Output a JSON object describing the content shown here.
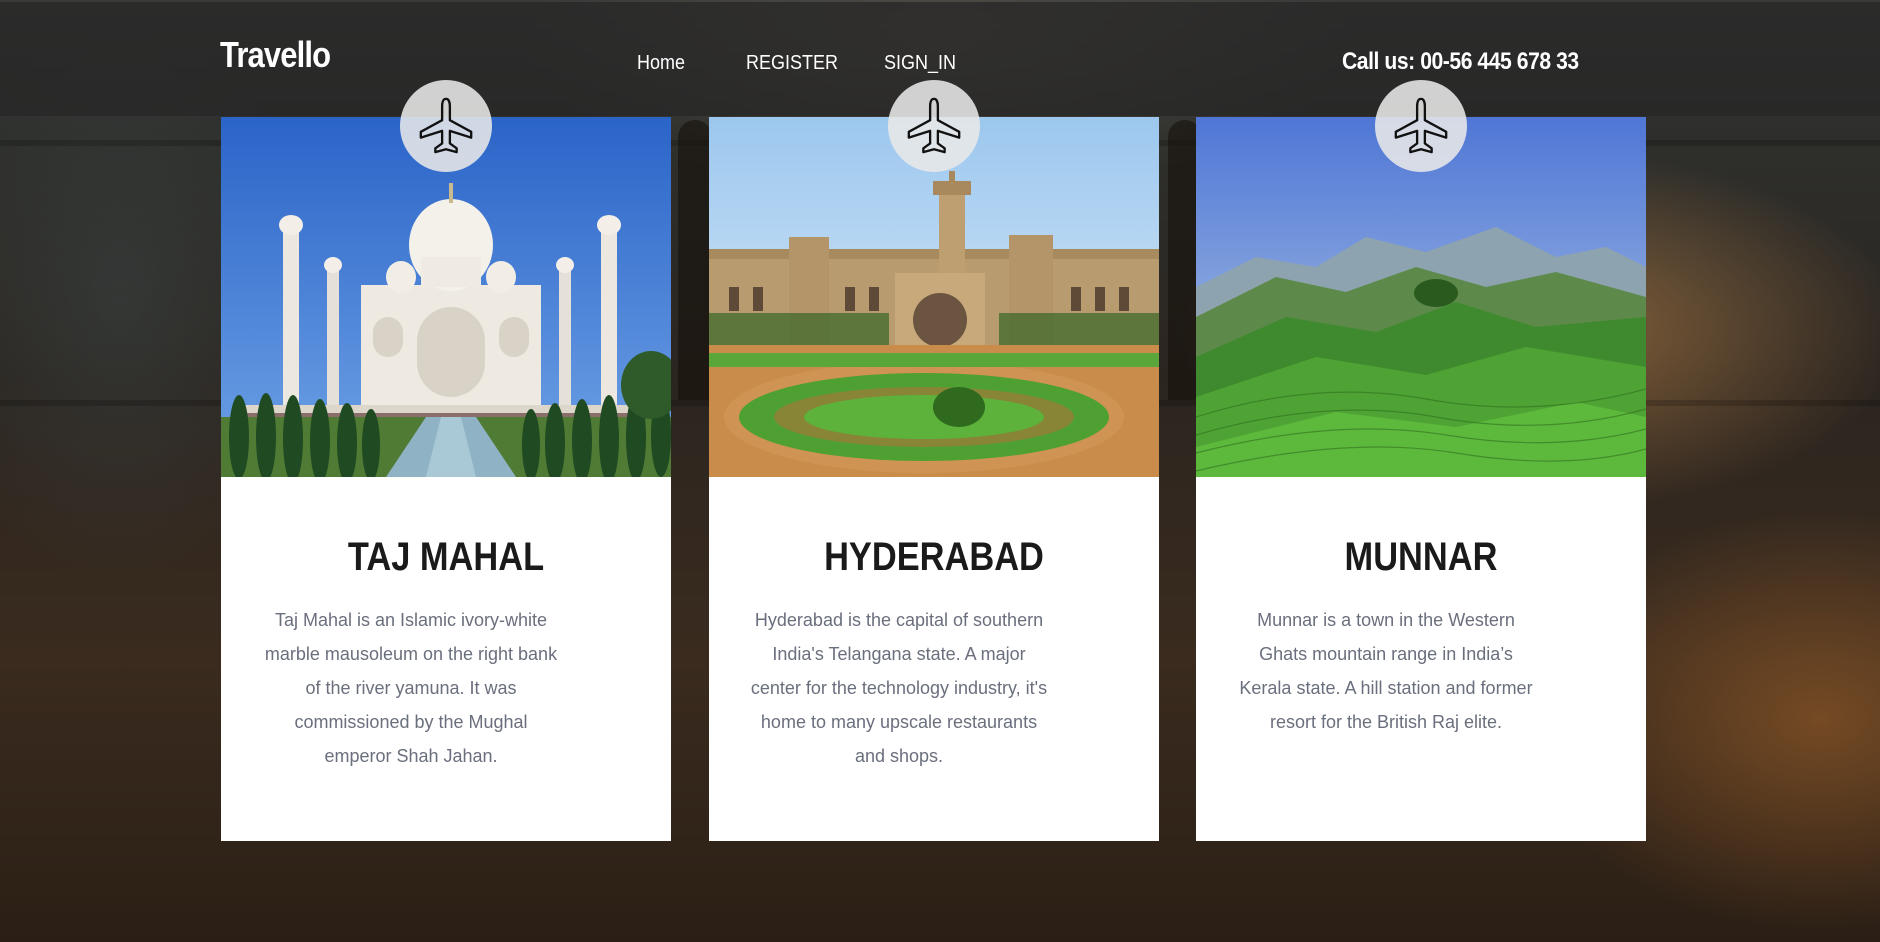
{
  "header": {
    "brand": "Travello",
    "nav": [
      {
        "label": "Home"
      },
      {
        "label": "REGISTER"
      },
      {
        "label": "SIGN_IN"
      }
    ],
    "phone": "Call us: 00-56 445 678 33"
  },
  "cards": [
    {
      "title": "TAJ MAHAL",
      "description": "Taj Mahal is an Islamic ivory-white marble mausoleum on the right bank of the river yamuna. It was commissioned by the Mughal emperor Shah Jahan.",
      "icon": "airplane-icon"
    },
    {
      "title": "HYDERABAD",
      "description": "Hyderabad is the capital of southern India's Telangana state. A major center for the technology industry, it's home to many upscale restaurants and shops.",
      "icon": "airplane-icon"
    },
    {
      "title": "MUNNAR",
      "description": "Munnar is a town in the Western Ghats mountain range in India’s Kerala state. A hill station and former resort for the British Raj elite.",
      "icon": "airplane-icon"
    }
  ],
  "colors": {
    "header_bg": "#262626",
    "card_bg": "#ffffff",
    "title": "#1a1a1a",
    "body_text": "#6a6f7d"
  }
}
